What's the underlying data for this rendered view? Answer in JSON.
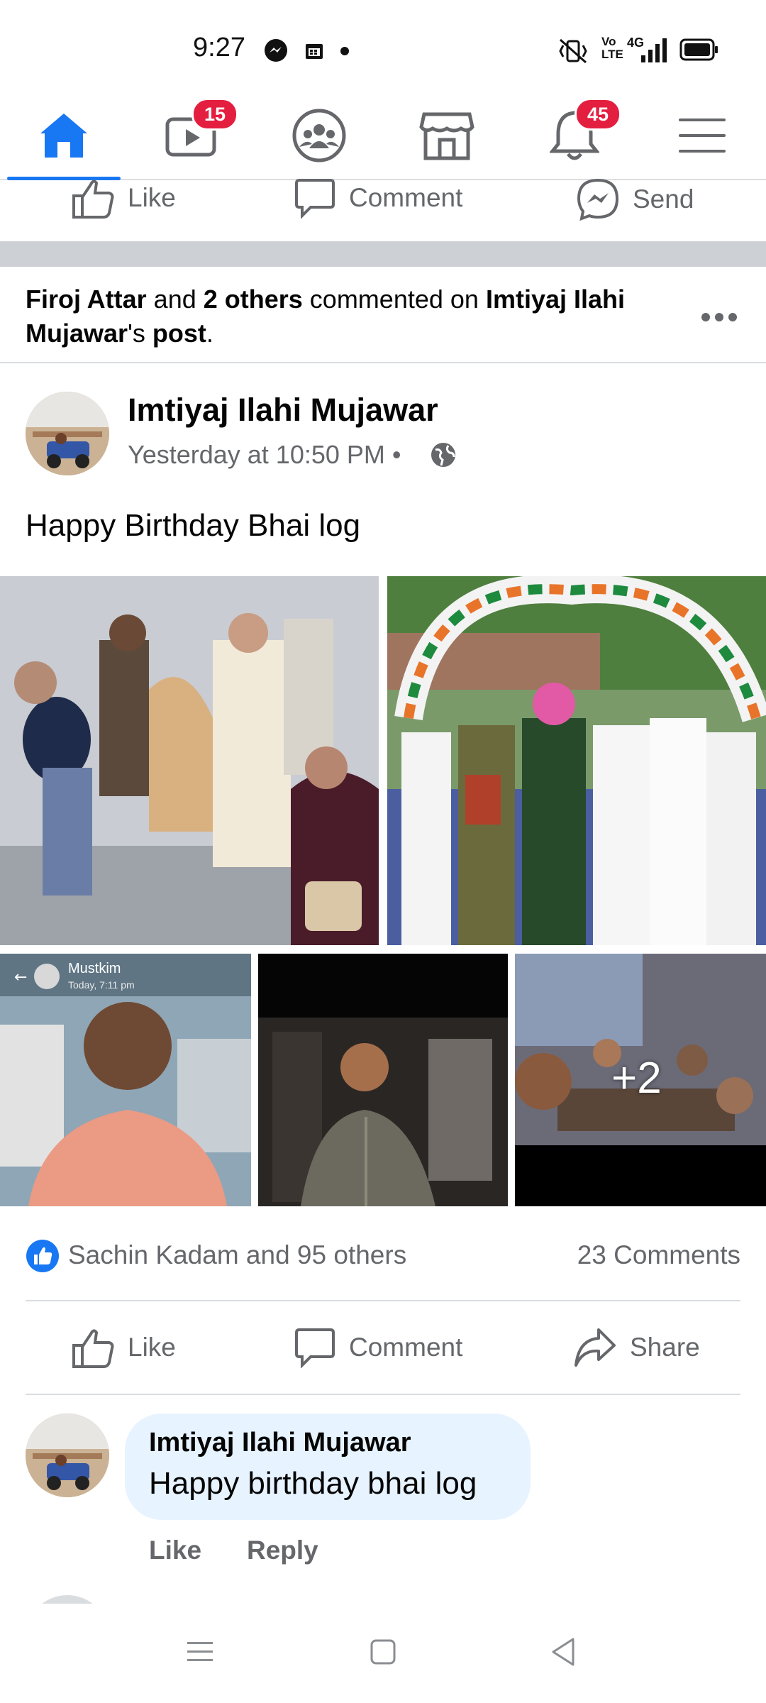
{
  "status_bar": {
    "time": "9:27",
    "icons": [
      "messenger-icon",
      "calendar-icon",
      "dot-icon",
      "vibrate-icon",
      "volte-icon",
      "signal-icon",
      "battery-icon"
    ],
    "network": "4G",
    "volte": "Vo LTE"
  },
  "nav": {
    "items": [
      "home-icon",
      "watch-icon",
      "groups-icon",
      "marketplace-icon",
      "notifications-icon",
      "menu-icon"
    ],
    "watch_badge": "15",
    "notifications_badge": "45",
    "accent": "#1877f2"
  },
  "top_actions": {
    "like": "Like",
    "comment": "Comment",
    "send": "Send"
  },
  "story": {
    "actor1": "Firoj Attar",
    "and1": " and ",
    "others": "2 others",
    "mid": " commented on ",
    "owner": "Imtiyaj Ilahi",
    "owner2": "Mujawar",
    "poss": "'s ",
    "post": "post",
    "dot": "."
  },
  "post": {
    "author": "Imtiyaj Ilahi Mujawar",
    "time": "Yesterday at 10:50 PM",
    "sep": "•",
    "text": "Happy Birthday Bhai log",
    "photos_more": "+2",
    "photo3_name": "Mustkim",
    "photo3_time": "Today, 7:11 pm",
    "reactions": "Sachin Kadam and 95 others",
    "comments_count": "23 Comments"
  },
  "post_actions": {
    "like": "Like",
    "comment": "Comment",
    "share": "Share"
  },
  "comment": {
    "author": "Imtiyaj Ilahi Mujawar",
    "text": "Happy birthday bhai log",
    "like": "Like",
    "reply": "Reply"
  }
}
